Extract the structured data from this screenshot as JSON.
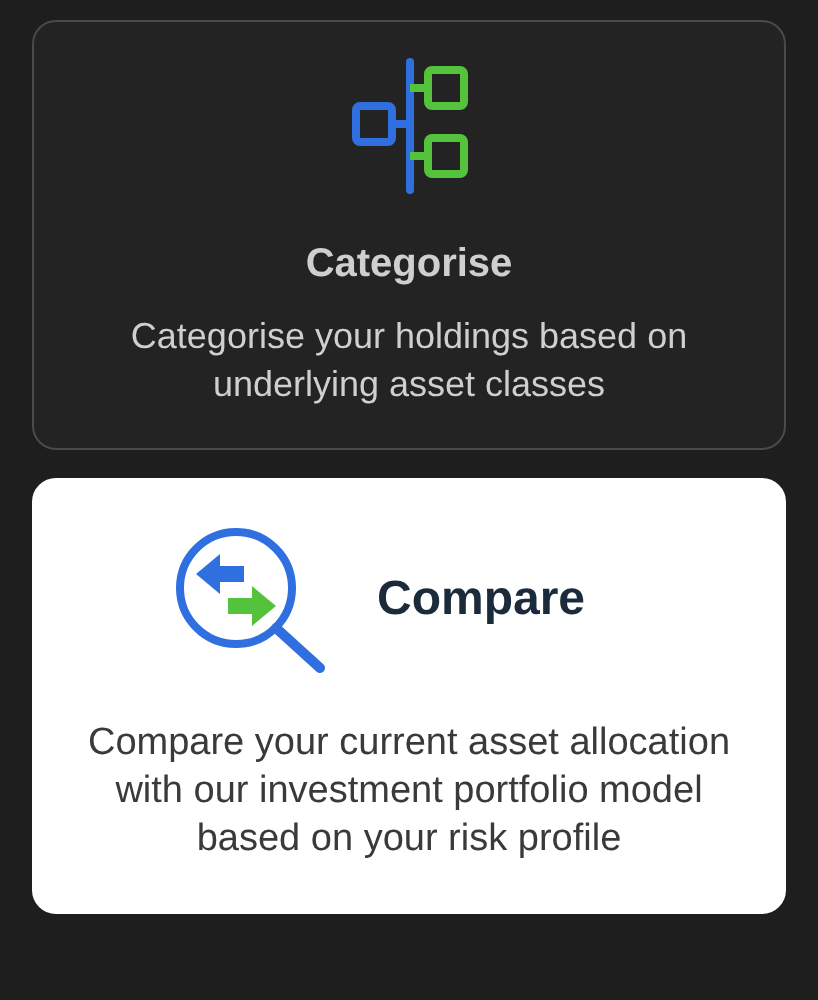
{
  "cards": [
    {
      "title": "Categorise",
      "description": "Categorise your holdings based on underlying asset classes",
      "selected": false,
      "kind": "stacked"
    },
    {
      "title": "Compare",
      "description": "Compare your current asset allocation with our investment portfolio model based on your risk profile",
      "selected": true,
      "kind": "inline"
    }
  ]
}
